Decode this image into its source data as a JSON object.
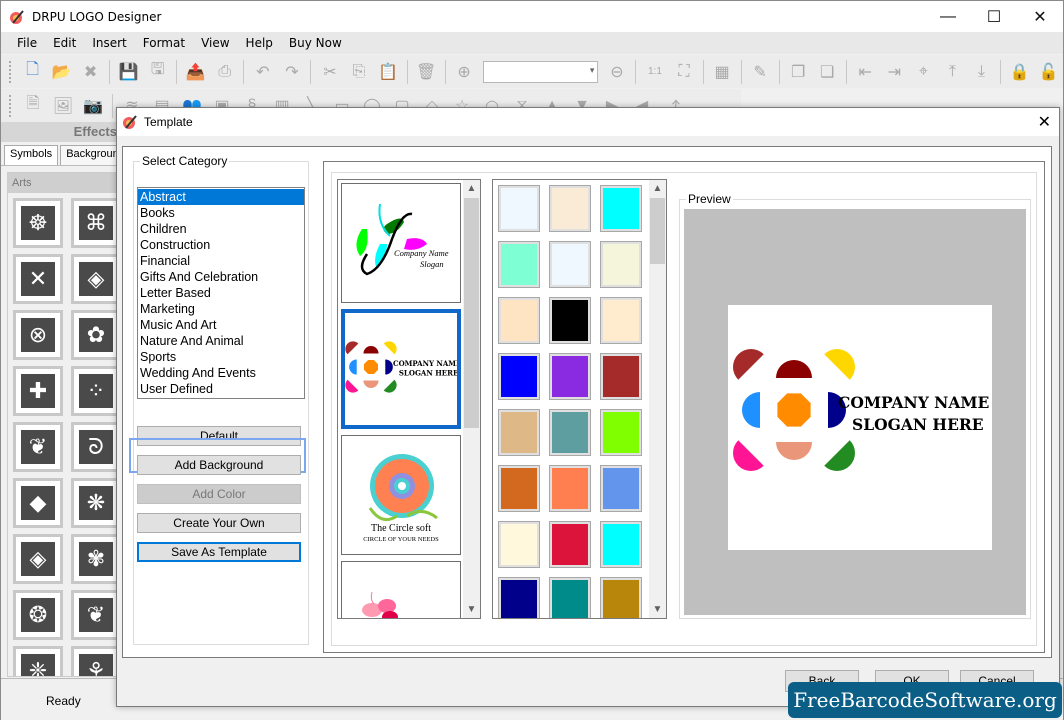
{
  "window": {
    "title": "DRPU LOGO Designer",
    "controls": {
      "minimize": "—",
      "maximize": "☐",
      "close": "✕"
    }
  },
  "menu": [
    "File",
    "Edit",
    "Insert",
    "Format",
    "View",
    "Help",
    "Buy Now"
  ],
  "toolbar1": {
    "icons": [
      "new-file-icon",
      "open-folder-icon",
      "close-file-icon",
      "save-icon",
      "save-as-icon",
      "export-icon",
      "print-icon",
      "undo-icon",
      "redo-icon",
      "cut-icon",
      "copy-icon",
      "paste-icon",
      "delete-icon",
      "zoom-in-icon"
    ],
    "zoom_value": "",
    "icons_after": [
      "zoom-out-icon",
      "actual-size-icon",
      "fit-to-window-icon",
      "grid-icon",
      "edit-icon",
      "bring-forward-icon",
      "send-backward-icon",
      "align-left-icon",
      "align-right-icon",
      "center-icon",
      "align-top-icon",
      "align-bottom-icon",
      "lock-icon",
      "unlock-icon"
    ]
  },
  "toolbar2": {
    "icons": [
      "text-icon",
      "add-image-icon",
      "camera-icon",
      "layers-icon",
      "gallery-icon",
      "users-icon",
      "watermark-icon",
      "signature-icon",
      "barcode-icon",
      "line-icon",
      "rectangle-icon",
      "ellipse-icon",
      "rounded-rect-icon",
      "diamond-icon",
      "star-icon",
      "arc-icon",
      "bowtie-icon",
      "triangle-up-icon",
      "triangle-down-icon",
      "triangle-right-icon",
      "triangle-left-icon",
      "curve-icon"
    ]
  },
  "effects_panel": {
    "header": "Effects",
    "tabs": [
      "Symbols",
      "Background"
    ],
    "active_tab": "Symbols",
    "section": "Arts",
    "symbols": [
      "☸",
      "⌘",
      "✕",
      "◈",
      "⊗",
      "✿",
      "✚",
      "⁘",
      "❦",
      "ᘐ",
      "◆",
      "❋",
      "◈",
      "✾",
      "❂",
      "❦",
      "❈",
      "⚘"
    ]
  },
  "status": {
    "text": "Ready"
  },
  "dialog": {
    "title": "Template",
    "category_group_label": "Select Category",
    "categories": [
      "Abstract",
      "Books",
      "Children",
      "Construction",
      "Financial",
      "Gifts And Celebration",
      "Letter Based",
      "Marketing",
      "Music And Art",
      "Nature And Animal",
      "Sports",
      "Wedding And Events",
      "User Defined"
    ],
    "selected_category": "Abstract",
    "buttons": {
      "default": "Default",
      "add_background": "Add Background",
      "add_color": "Add Color",
      "create_your_own": "Create Your Own",
      "save_as_template": "Save As Template"
    },
    "templates": [
      {
        "name": "leaves-logo",
        "line1": "Company Name",
        "line2": "Slogan"
      },
      {
        "name": "petals-logo",
        "line1": "COMPANY NAME",
        "line2": "SLOGAN HERE",
        "selected": true
      },
      {
        "name": "circle-logo",
        "line1": "The Circle soft",
        "line2": "CIRCLE OF YOUR NEEDS"
      },
      {
        "name": "butterfly-logo",
        "line1": "",
        "line2": ""
      }
    ],
    "colors": [
      "#f0f8ff",
      "#faebd7",
      "#00ffff",
      "#7fffd4",
      "#f0f8ff",
      "#f5f5dc",
      "#ffe4c4",
      "#000000",
      "#ffebcd",
      "#0000ff",
      "#8a2be2",
      "#a52a2a",
      "#deb887",
      "#5f9ea0",
      "#7fff00",
      "#d2691e",
      "#ff7f50",
      "#6495ed",
      "#fff8dc",
      "#dc143c",
      "#00ffff",
      "#00008b",
      "#008b8b",
      "#b8860b"
    ],
    "preview_label": "Preview",
    "preview": {
      "company": "COMPANY NAME",
      "slogan": "SLOGAN HERE",
      "petal_colors": {
        "top_left": "#a52a2a",
        "top": "#8b0000",
        "top_right": "#ffd700",
        "left": "#1e90ff",
        "center": "#ff8c00",
        "right": "#00008b",
        "bottom_left": "#ff1493",
        "bottom": "#e9967a",
        "bottom_right": "#228b22"
      }
    },
    "footer": {
      "back": "Back",
      "ok": "OK",
      "cancel": "Cancel"
    }
  },
  "watermark": "FreeBarcodeSoftware.org"
}
